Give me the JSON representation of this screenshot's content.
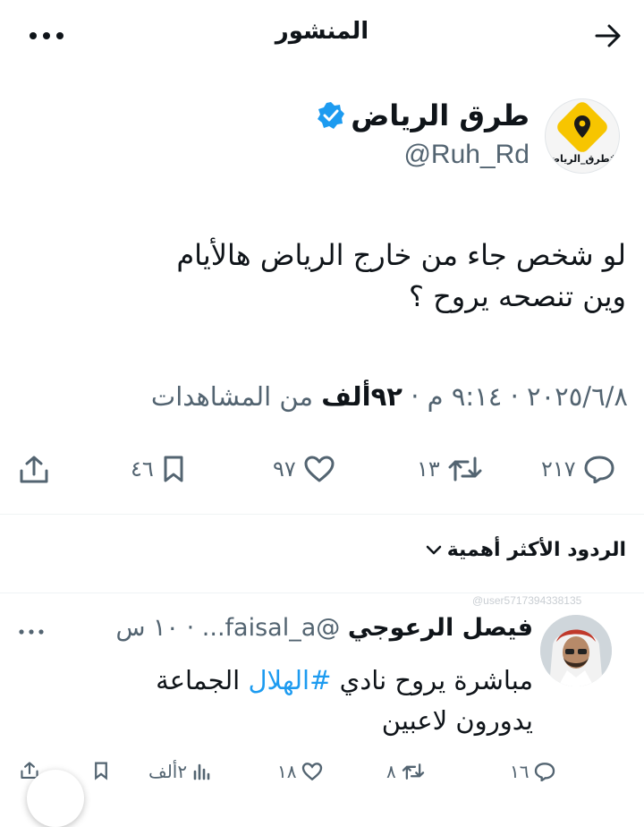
{
  "header": {
    "title": "المنشور"
  },
  "author": {
    "name": "طرق الرياض",
    "handle": "@Ruh_Rd",
    "avatar_caption": "#طرق_الرياض"
  },
  "post": {
    "text_line1": "لو شخص جاء من خارج الرياض هالأيام",
    "text_line2": "وين تنصحه يروح ؟",
    "date": "٢٠٢٥/٦/٨",
    "time": "٩:١٤ م",
    "views_count": "٩٢ألف",
    "views_label": "من المشاهدات",
    "dot": "·"
  },
  "actions": {
    "replies": "٢١٧",
    "reposts": "١٣",
    "likes": "٩٧",
    "bookmarks": "٤٦"
  },
  "replies_sort": {
    "label": "الردود الأكثر أهمية"
  },
  "watermark": "@user5717394338135",
  "reply": {
    "name": "فيصل الرعوجي",
    "handle": "@faisal_a...",
    "time": "١٠ س",
    "text_before": "مباشرة يروح نادي",
    "hashtag": "#الهلال",
    "text_after": "الجماعة",
    "text_line2": "يدورون لاعبين",
    "actions": {
      "replies": "١٦",
      "reposts": "٨",
      "likes": "١٨",
      "views": "٢ألف"
    }
  },
  "colors": {
    "accent": "#1d9bf0",
    "text": "#0f1419",
    "muted": "#536471",
    "logo_yellow": "#f7c500"
  }
}
